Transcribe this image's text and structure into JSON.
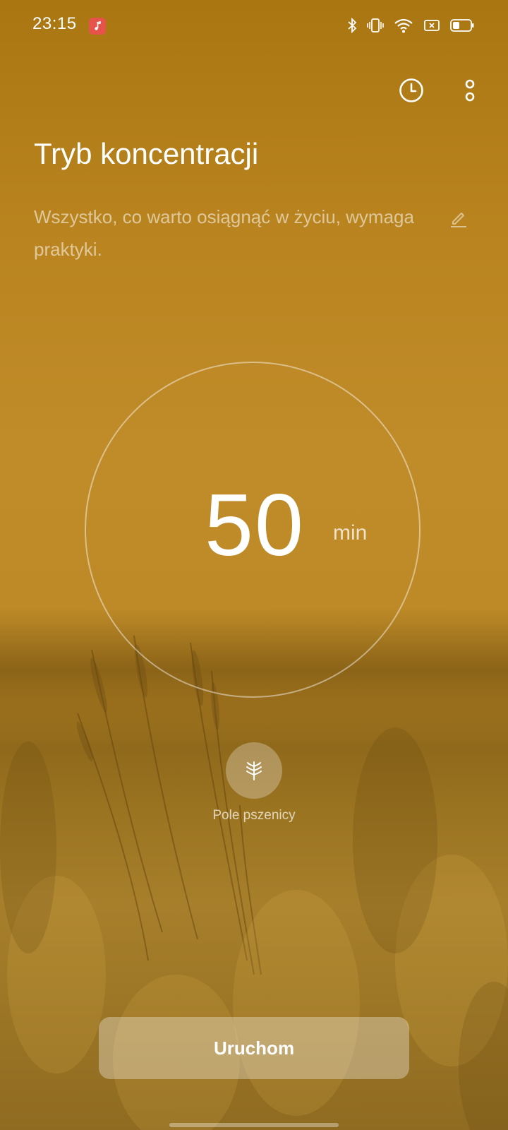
{
  "status_bar": {
    "time": "23:15",
    "notification_icon": "music-note-icon",
    "icons": [
      "bluetooth-icon",
      "vibrate-icon",
      "wifi-icon",
      "sim-card-x-icon",
      "battery-icon"
    ]
  },
  "toolbar": {
    "history_icon": "clock-icon",
    "menu_icon": "more-vertical-icon"
  },
  "page": {
    "title": "Tryb koncentracji",
    "quote": "Wszystko, co warto osiągnąć w życiu, wymaga praktyki.",
    "edit_icon": "edit-pencil-icon"
  },
  "timer": {
    "value": "50",
    "unit": "min"
  },
  "scene": {
    "icon": "wheat-icon",
    "label": "Pole pszenicy"
  },
  "actions": {
    "start_label": "Uruchom"
  },
  "colors": {
    "background": "#bd8a27",
    "music_badge": "#e5534b"
  }
}
